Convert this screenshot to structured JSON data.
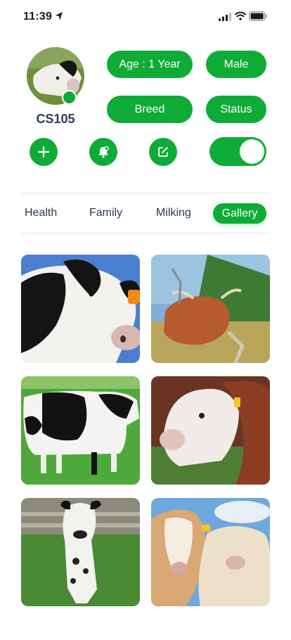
{
  "status_bar": {
    "time": "11:39"
  },
  "profile": {
    "cow_id": "CS105"
  },
  "attributes": {
    "age": "Age : 1 Year",
    "sex": "Male",
    "breed": "Breed",
    "status": "Status"
  },
  "actions": {
    "add_icon": "plus-icon",
    "alert_icon": "bell-icon",
    "edit_icon": "edit-icon",
    "toggle_on": true
  },
  "tabs": [
    {
      "label": "Health",
      "active": false
    },
    {
      "label": "Family",
      "active": false
    },
    {
      "label": "Milking",
      "active": false
    },
    {
      "label": "Gallery",
      "active": true
    }
  ],
  "gallery": [
    {
      "subject": "holstein-cow-closeup"
    },
    {
      "subject": "highland-cattle"
    },
    {
      "subject": "holstein-cow-in-field"
    },
    {
      "subject": "hereford-cow"
    },
    {
      "subject": "spotted-calf"
    },
    {
      "subject": "charolais-cows"
    }
  ],
  "colors": {
    "accent": "#0eac36",
    "text_dark": "#2b3f5a",
    "divider": "#e2e4e8"
  }
}
